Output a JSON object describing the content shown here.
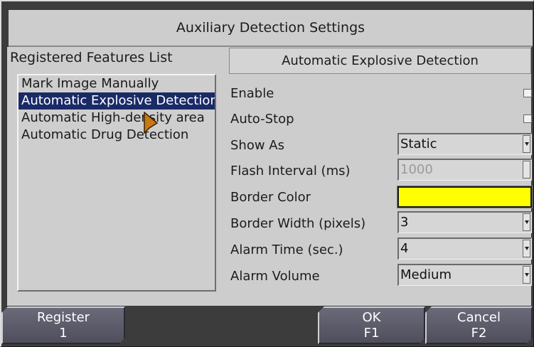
{
  "dialog": {
    "title": "Auxiliary Detection Settings"
  },
  "features": {
    "label": "Registered Features List",
    "items": [
      "Mark Image Manually",
      "Automatic Explosive Detection",
      "Automatic High-density area",
      "Automatic Drug Detection"
    ],
    "selected_index": 1
  },
  "settings": {
    "header": "Automatic Explosive Detection",
    "enable": {
      "label": "Enable",
      "checked": false
    },
    "auto_stop": {
      "label": "Auto-Stop",
      "checked": false
    },
    "show_as": {
      "label": "Show As",
      "value": "Static"
    },
    "flash_interval": {
      "label": "Flash Interval (ms)",
      "value": "1000"
    },
    "border_color": {
      "label": "Border Color",
      "color": "#ffff00"
    },
    "border_width": {
      "label": "Border Width (pixels)",
      "value": "3"
    },
    "alarm_time": {
      "label": "Alarm Time (sec.)",
      "value": "4"
    },
    "alarm_volume": {
      "label": "Alarm Volume",
      "value": "Medium"
    }
  },
  "buttons": {
    "register": {
      "label": "Register",
      "key": "1"
    },
    "ok": {
      "label": "OK",
      "key": "F1"
    },
    "cancel": {
      "label": "Cancel",
      "key": "F2"
    }
  },
  "colors": {
    "selection": "#1a2a66",
    "button": "#5a5a68",
    "panel": "#cdcdcd"
  },
  "icons": {
    "cursor": "pointer-cursor-icon",
    "dropdown": "chevron-down-icon"
  }
}
